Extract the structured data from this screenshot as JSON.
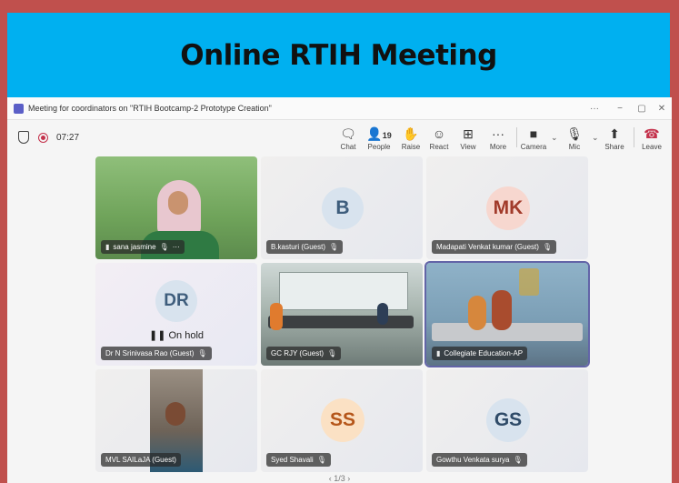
{
  "banner": {
    "title": "Online RTIH Meeting"
  },
  "window": {
    "title": "Meeting for coordinators on \"RTIH Bootcamp-2 Prototype Creation\"",
    "more": "···",
    "minimize": "−",
    "maximize": "▢",
    "close": "✕"
  },
  "toolbar": {
    "timer": "07:27",
    "chat": "Chat",
    "people": "People",
    "people_count": "19",
    "raise": "Raise",
    "react": "React",
    "view": "View",
    "more": "More",
    "more_glyph": "···",
    "camera": "Camera",
    "mic": "Mic",
    "share": "Share",
    "leave": "Leave"
  },
  "participants": [
    {
      "name": "sana jasmine",
      "extra": "···",
      "video": true
    },
    {
      "name": "B.kasturi (Guest)",
      "initials": "B"
    },
    {
      "name": "Madapati Venkat kumar (Guest)",
      "initials": "MK"
    },
    {
      "name": "Dr N Srinivasa Rao (Guest)",
      "initials": "DR",
      "status": "On hold"
    },
    {
      "name": "GC RJY (Guest)",
      "video": true
    },
    {
      "name": "Collegiate Education-AP",
      "video": true
    },
    {
      "name": "MVL SAILaJA (Guest)",
      "video": true
    },
    {
      "name": "Syed Shavali",
      "initials": "SS"
    },
    {
      "name": "Gowthu Venkata surya",
      "initials": "GS"
    }
  ],
  "pager": {
    "prev": "‹",
    "text": "1/3",
    "next": "›"
  },
  "colors": {
    "banner": "#00b0f0",
    "border": "#c0504d",
    "accent": "#6264a7",
    "leave": "#c4314b"
  }
}
